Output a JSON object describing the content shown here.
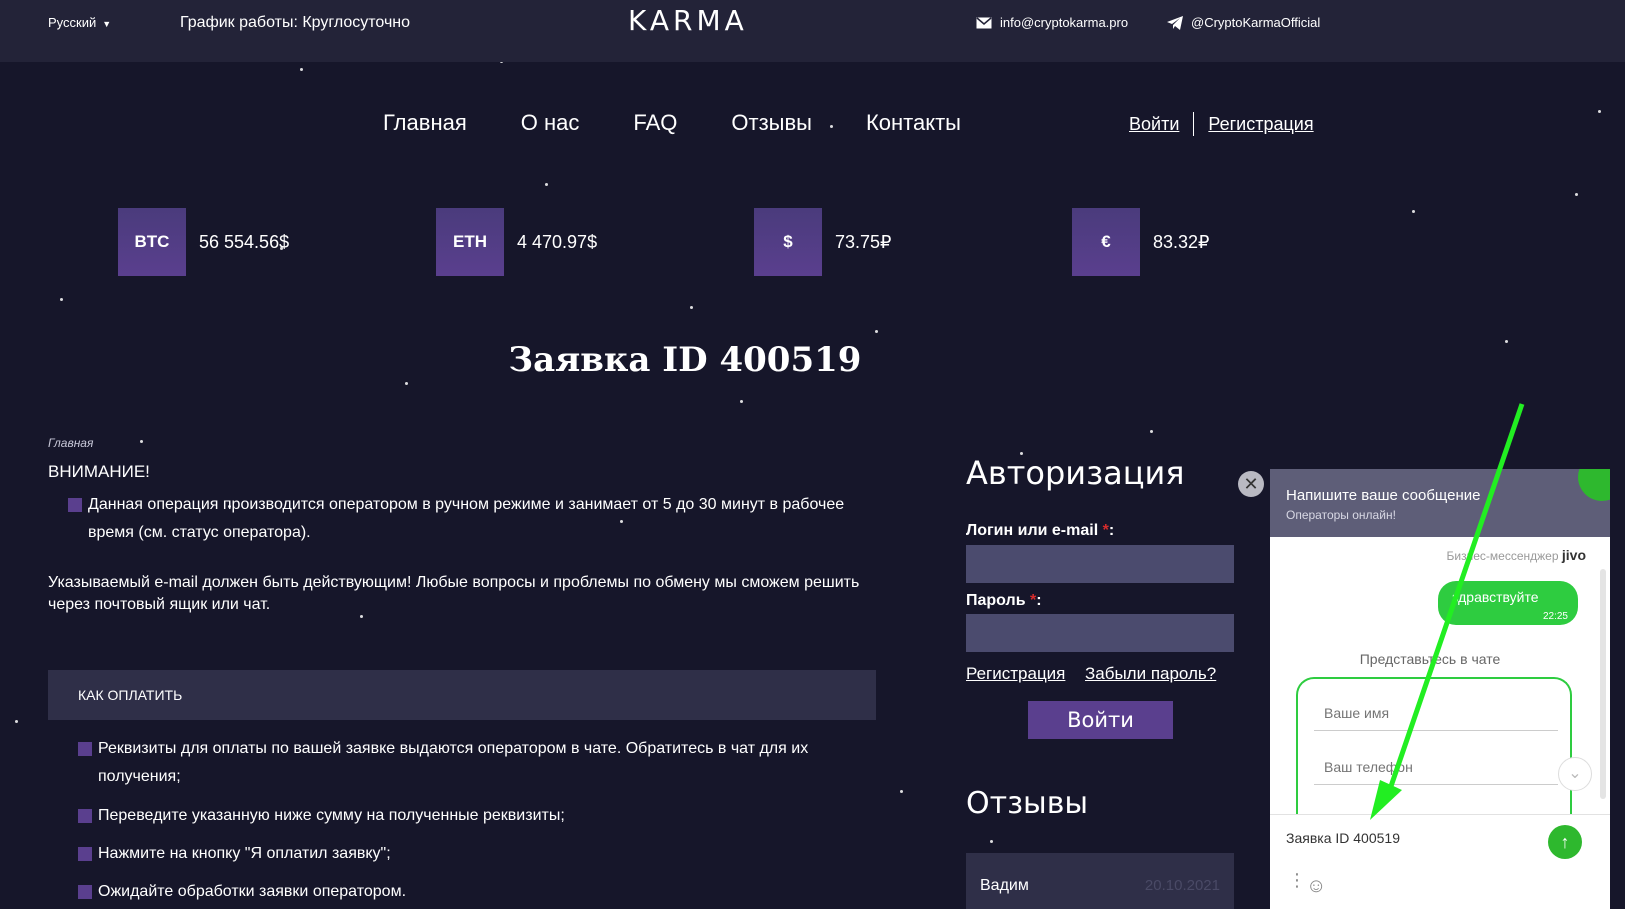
{
  "topbar": {
    "language": "Русский",
    "schedule": "График работы: Круглосуточно",
    "logo": "KARMA",
    "email": "info@cryptokarma.pro",
    "telegram": "@CryptoKarmaOfficial"
  },
  "nav": {
    "items": [
      "Главная",
      "О нас",
      "FAQ",
      "Отзывы",
      "Контакты"
    ],
    "login": "Войти",
    "register": "Регистрация"
  },
  "rates": [
    {
      "label": "BTC",
      "value": "56 554.56$"
    },
    {
      "label": "ETH",
      "value": "4 470.97$"
    },
    {
      "label": "$",
      "value": "73.75₽"
    },
    {
      "label": "€",
      "value": "83.32₽"
    }
  ],
  "main": {
    "title": "Заявка ID 400519",
    "breadcrumb": "Главная",
    "warning_title": "ВНИМАНИЕ!",
    "warning_bullet": "Данная операция производится оператором в ручном режиме и занимает от 5 до 30 минут в рабочее время (см. статус оператора).",
    "paragraph": "Указываемый e-mail должен быть действующим! Любые вопросы и проблемы по обмену мы сможем решить через почтовый ящик или чат.",
    "howpay_title": "КАК ОПЛАТИТЬ",
    "howpay_steps": [
      "Реквизиты для оплаты по вашей заявке выдаются оператором в чате. Обратитесь в чат для их получения;",
      "Переведите указанную ниже сумму на полученные реквизиты;",
      "Нажмите на кнопку \"Я оплатил заявку\";",
      "Ожидайте обработки заявки оператором."
    ]
  },
  "auth": {
    "title": "Авторизация",
    "login_label": "Логин или e-mail",
    "password_label": "Пароль",
    "required_mark": "*",
    "colon": ":",
    "register_link": "Регистрация",
    "forgot_link": "Забыли пароль?",
    "submit": "Войти"
  },
  "reviews": {
    "title": "Отзывы",
    "first_name": "Вадим",
    "first_date": "20.10.2021"
  },
  "chat": {
    "header_title": "Напишите ваше сообщение",
    "header_subtitle": "Операторы онлайн!",
    "brand_text": "Бизнес-мессенджер",
    "brand_name": "jivo",
    "message": "здравствуйте",
    "message_time": "22:25",
    "intro": "Представьтесь в чате",
    "name_placeholder": "Ваше имя",
    "phone_placeholder": "Ваш телефон",
    "input_text": "Заявка ID 400519",
    "close_icon": "close-icon",
    "send_icon": "send-arrow-icon"
  },
  "colors": {
    "background": "#16162a",
    "accent": "#5a3f8e",
    "chat_green": "#2ecc40",
    "annotation_arrow": "#22ee22"
  }
}
